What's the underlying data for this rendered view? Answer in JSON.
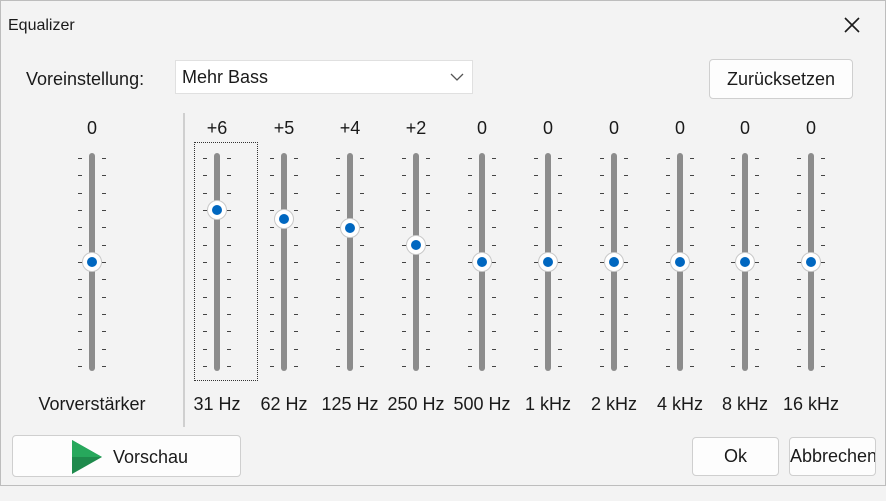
{
  "window": {
    "title": "Equalizer"
  },
  "preset": {
    "label": "Voreinstellung:",
    "selected": "Mehr Bass"
  },
  "reset_label": "Zurücksetzen",
  "preamp": {
    "label": "Vorverstärker",
    "value": "0",
    "gain_db": 0
  },
  "range_db": [
    -12,
    12
  ],
  "bands": [
    {
      "freq": "31 Hz",
      "value": "+6",
      "gain_db": 6
    },
    {
      "freq": "62 Hz",
      "value": "+5",
      "gain_db": 5
    },
    {
      "freq": "125 Hz",
      "value": "+4",
      "gain_db": 4
    },
    {
      "freq": "250 Hz",
      "value": "+2",
      "gain_db": 2
    },
    {
      "freq": "500 Hz",
      "value": "0",
      "gain_db": 0
    },
    {
      "freq": "1 kHz",
      "value": "0",
      "gain_db": 0
    },
    {
      "freq": "2 kHz",
      "value": "0",
      "gain_db": 0
    },
    {
      "freq": "4 kHz",
      "value": "0",
      "gain_db": 0
    },
    {
      "freq": "8 kHz",
      "value": "0",
      "gain_db": 0
    },
    {
      "freq": "16 kHz",
      "value": "0",
      "gain_db": 0
    }
  ],
  "buttons": {
    "preview": "Vorschau",
    "ok": "Ok",
    "cancel": "Abbrechen"
  },
  "icons": {
    "close": "close-icon",
    "dropdown": "chevron-down-icon",
    "preview": "play-icon"
  },
  "colors": {
    "accent": "#0067c0",
    "track": "#8c8c8c",
    "play": "#1e8a4c"
  }
}
